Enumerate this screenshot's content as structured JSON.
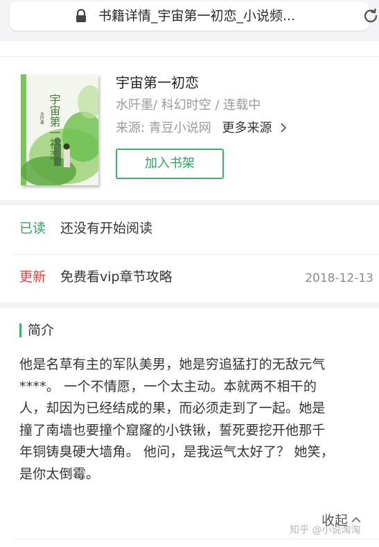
{
  "browser": {
    "url_title": "书籍详情_宇宙第一初恋_小说频..."
  },
  "book": {
    "title": "宇宙第一初恋",
    "meta": "水阡墨/ 科幻时空 / 连载中",
    "source_label": "来源:  青豆小说网",
    "more_sources": "更多来源",
    "add_to_shelf": "加入书架",
    "cover": {
      "cover_title": "宇宙第一初恋",
      "cover_author": "水阡墨",
      "accent_color": "#6abf4b"
    }
  },
  "status": {
    "read_tag": "已读",
    "read_text": "还没有开始阅读",
    "update_tag": "更新",
    "update_text": "免费看vip章节攻略",
    "update_date": "2018-12-13"
  },
  "intro": {
    "heading": "简介",
    "lines": [
      "他是名草有主的军队美男，她是穷追猛打的无敌元气",
      "****。 一个不情愿，一个太主动。本就两不相干的",
      "人，却因为已经结成的果，而必须走到了一起。她是",
      "撞了南墙也要撞个窟窿的小铁锹，誓死要挖开他那千",
      "年铜铸臭硬大墙角。 他问，是我运气太好了？ 她笑，",
      "是你太倒霉。"
    ],
    "collapse_label": "收起",
    "watermark": "知乎 @小说淘淘"
  },
  "colors": {
    "green": "#3ab26b",
    "red": "#e0453c",
    "band": "#f2f2f4"
  }
}
